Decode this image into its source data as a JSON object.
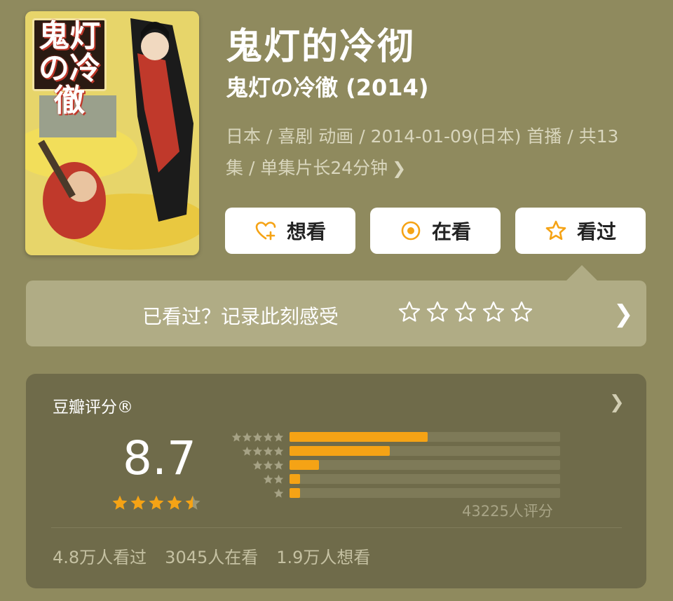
{
  "poster": {
    "logo_text": "鬼灯の冷徹"
  },
  "title": "鬼灯的冷彻",
  "original_title": "鬼灯の冷徹 (2014)",
  "meta": {
    "line1": "日本 / 喜剧 动画 / 2014-01-09(日本) 首播 / 共13",
    "line2": "集 / 单集片长24分钟"
  },
  "actions": {
    "want": "想看",
    "watching": "在看",
    "watched": "看过"
  },
  "record": {
    "prompt": "已看过？记录此刻感受"
  },
  "rating": {
    "title": "豆瓣评分®",
    "score": "8.7",
    "stars": 4.5,
    "distribution": [
      {
        "stars": 5,
        "fraction": 0.51
      },
      {
        "stars": 4,
        "fraction": 0.37
      },
      {
        "stars": 3,
        "fraction": 0.11
      },
      {
        "stars": 2,
        "fraction": 0.04
      },
      {
        "stars": 1,
        "fraction": 0.04
      }
    ],
    "count_text": "43225人评分"
  },
  "stats": {
    "watched": "4.8万人看过",
    "watching": "3045人在看",
    "want": "1.9万人想看"
  },
  "colors": {
    "background": "#8f8a5e",
    "accent": "#f5a315",
    "card": "#6f6b4a"
  }
}
